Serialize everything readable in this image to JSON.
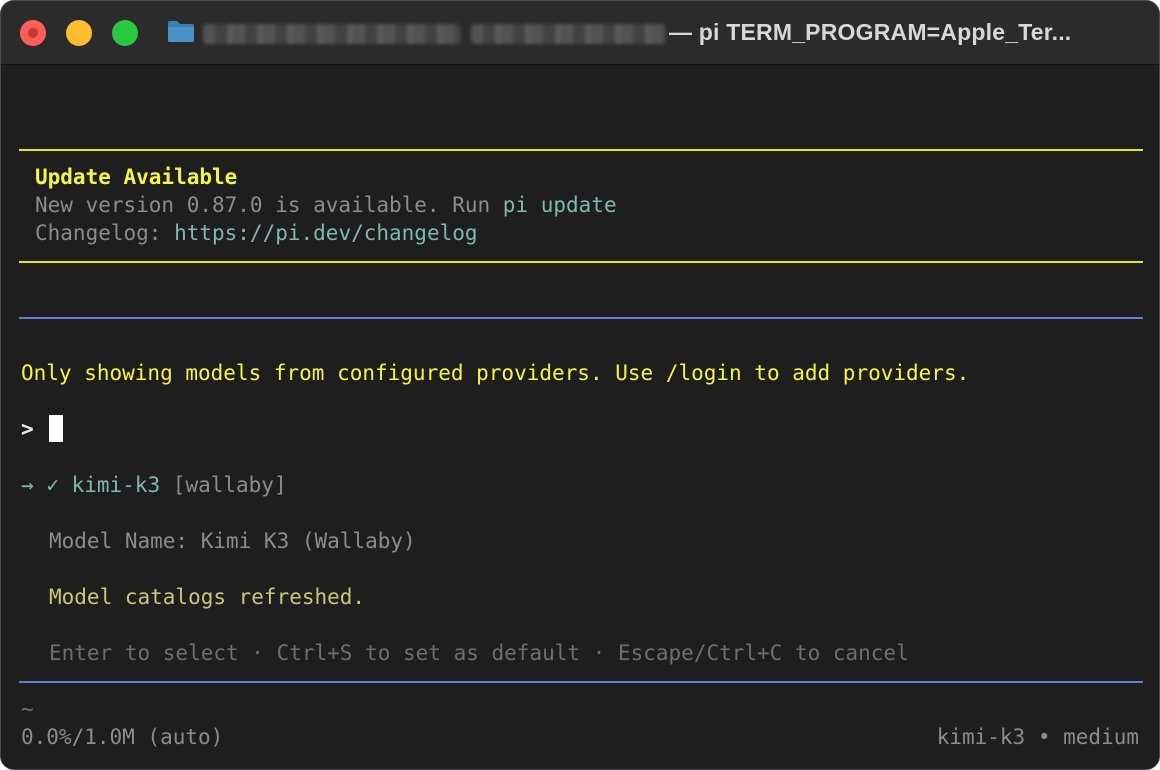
{
  "window": {
    "title": "— pi TERM_PROGRAM=Apple_Ter..."
  },
  "update_box": {
    "heading": "Update Available",
    "version_prefix": "New version 0.87.0 is available. Run ",
    "update_command": "pi update",
    "changelog_label": "Changelog: ",
    "changelog_url": "https://pi.dev/changelog"
  },
  "selector": {
    "notice": "Only showing models from configured providers. Use /login to add providers.",
    "prompt_symbol": ">",
    "selected_arrow": "→",
    "selected_check": "✓",
    "selected_model": "kimi-k3",
    "selected_provider": "[wallaby]",
    "model_name_line": "Model Name: Kimi K3 (Wallaby)",
    "refresh_message": "Model catalogs refreshed.",
    "hint": "Enter to select · Ctrl+S to set as default · Escape/Ctrl+C to cancel"
  },
  "status_bar": {
    "tilde": "~",
    "context_usage": "0.0%/1.0M (auto)",
    "model_status": "kimi-k3 • medium"
  },
  "colors": {
    "close": "#ff5f57",
    "minimize": "#febc2e",
    "maximize": "#28c840",
    "accent_yellow": "#f5f543",
    "rule_blue": "#5c7fd6",
    "teal": "#7fb8b0"
  }
}
